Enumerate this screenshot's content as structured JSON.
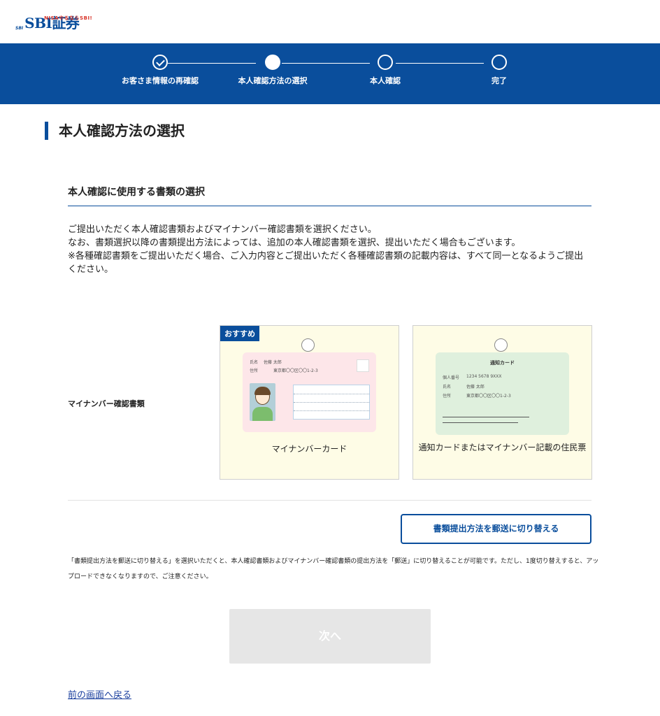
{
  "header": {
    "logo_group": "SBI",
    "logo_nisa": "NISAやるならSBI!",
    "logo_text": "SBI証券"
  },
  "steps": [
    {
      "label": "お客さま情報の再確認",
      "state": "done"
    },
    {
      "label": "本人確認方法の選択",
      "state": "current"
    },
    {
      "label": "本人確認",
      "state": "pending"
    },
    {
      "label": "完了",
      "state": "pending"
    }
  ],
  "page": {
    "title": "本人確認方法の選択",
    "section_heading": "本人確認に使用する書類の選択",
    "description": [
      "ご提出いただく本人確認書類およびマイナンバー確認書類を選択ください。",
      "なお、書類選択以降の書類提出方法によっては、追加の本人確認書類を選択、提出いただく場合もございます。",
      "※各種確認書類をご提出いただく場合、ご入力内容とご提出いただく各種確認書類の記載内容は、すべて同一となるようご提出ください。"
    ],
    "row_label": "マイナンバー確認書類"
  },
  "options": [
    {
      "badge": "おすすめ",
      "caption": "マイナンバーカード",
      "illustration": {
        "name_key": "氏名",
        "name_val": "佐藤 太郎",
        "addr_key": "住所",
        "addr_val": "東京都〇〇区〇〇1-2-3"
      }
    },
    {
      "caption": "通知カードまたはマイナンバー記載の住民票",
      "illustration": {
        "title": "通知カード",
        "num_key": "個人番号",
        "num_val": "1234 5678 9XXX",
        "name_key": "氏名",
        "name_val": "佐藤 太郎",
        "addr_key": "住所",
        "addr_val": "東京都〇〇区〇〇1-2-3"
      }
    }
  ],
  "switch_button": "書類提出方法を郵送に切り替える",
  "note": "「書類提出方法を郵送に切り替える」を選択いただくと、本人確認書類およびマイナンバー確認書類の提出方法を「郵送」に切り替えることが可能です。ただし、1度切り替えすると、アップロードできなくなりますので、ご注意ください。",
  "next_button": "次へ",
  "back_link": "前の画面へ戻る",
  "colors": {
    "brand": "#0a4e9c",
    "card_bg": "#fefce6",
    "disabled_btn": "#e6e6e6"
  }
}
